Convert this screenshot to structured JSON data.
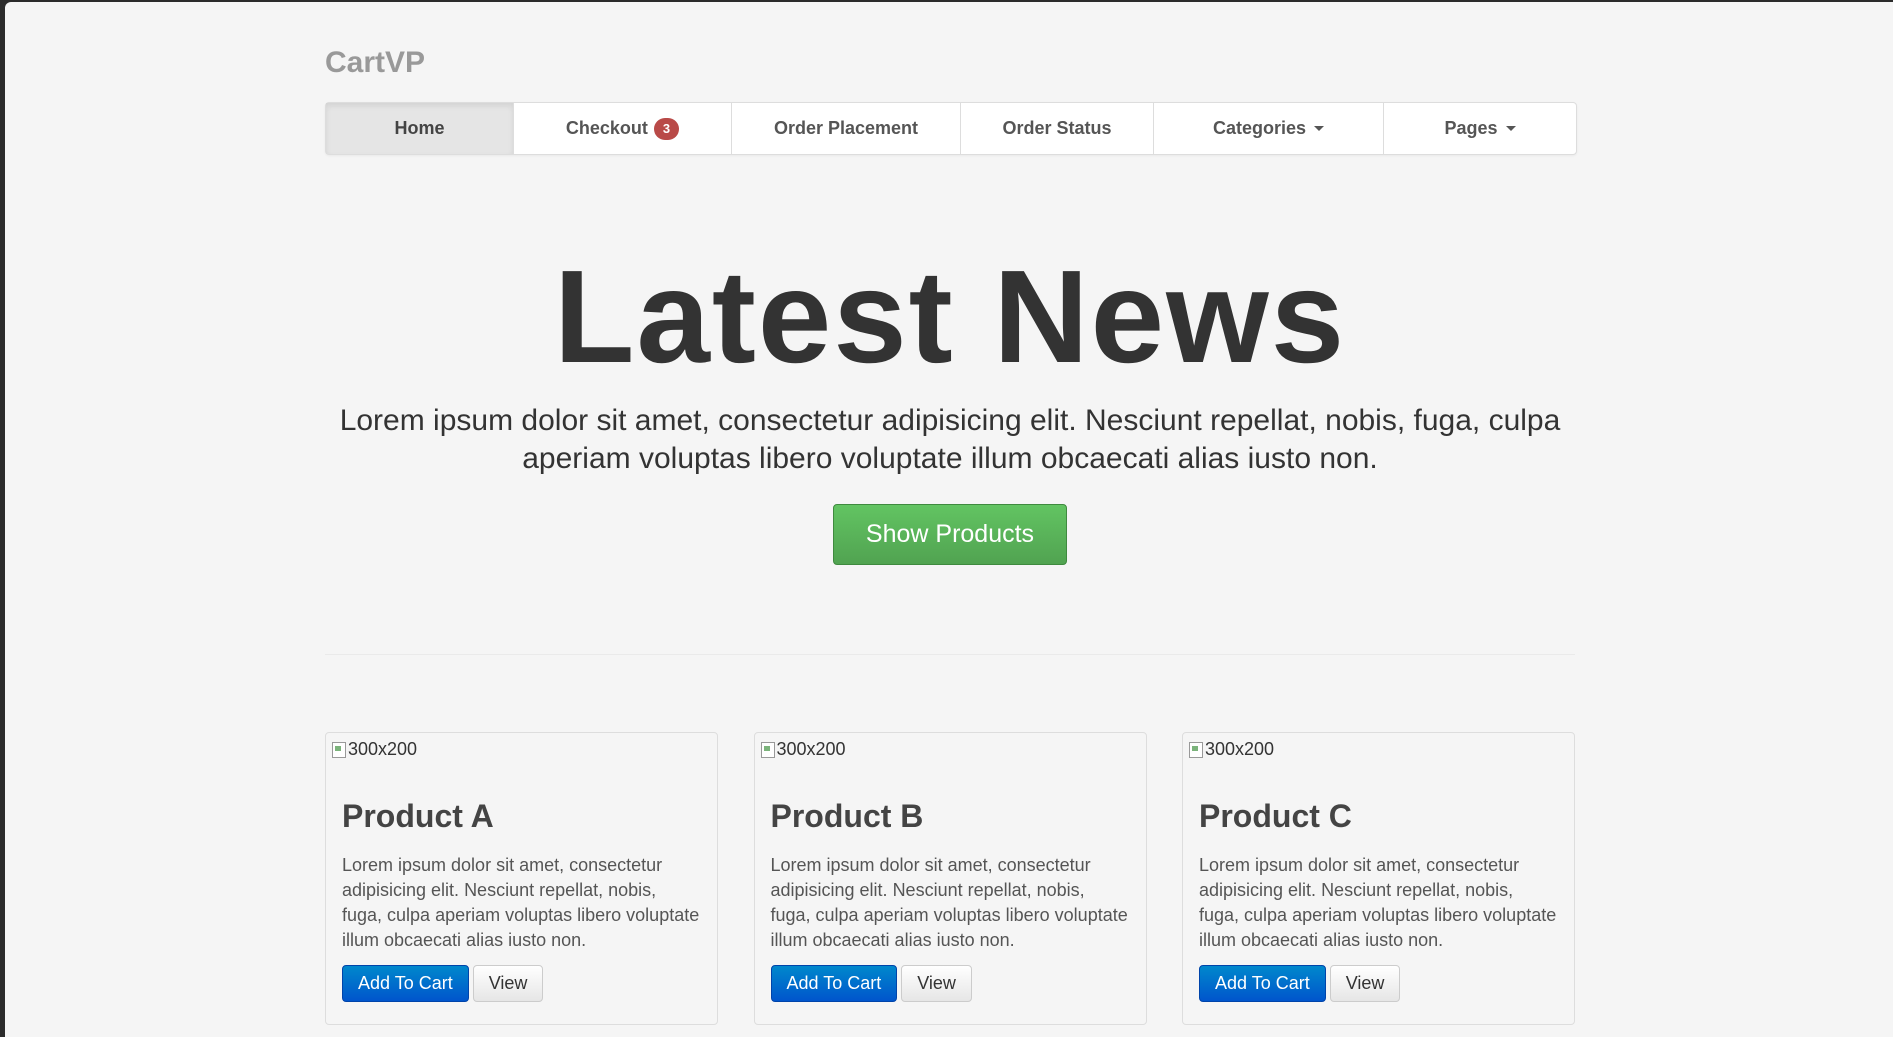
{
  "brand": "CartVP",
  "nav": {
    "home": "Home",
    "checkout": "Checkout",
    "checkout_badge": "3",
    "order_placement": "Order Placement",
    "order_status": "Order Status",
    "categories": "Categories",
    "pages": "Pages"
  },
  "hero": {
    "title": "Latest News",
    "text": "Lorem ipsum dolor sit amet, consectetur adipisicing elit. Nesciunt repellat, nobis, fuga, culpa aperiam voluptas libero voluptate illum obcaecati alias iusto non.",
    "button": "Show Products"
  },
  "products": [
    {
      "image_alt": "300x200",
      "title": "Product A",
      "description": "Lorem ipsum dolor sit amet, consectetur adipisicing elit. Nesciunt repellat, nobis, fuga, culpa aperiam voluptas libero voluptate illum obcaecati alias iusto non.",
      "add_label": "Add To Cart",
      "view_label": "View"
    },
    {
      "image_alt": "300x200",
      "title": "Product B",
      "description": "Lorem ipsum dolor sit amet, consectetur adipisicing elit. Nesciunt repellat, nobis, fuga, culpa aperiam voluptas libero voluptate illum obcaecati alias iusto non.",
      "add_label": "Add To Cart",
      "view_label": "View"
    },
    {
      "image_alt": "300x200",
      "title": "Product C",
      "description": "Lorem ipsum dolor sit amet, consectetur adipisicing elit. Nesciunt repellat, nobis, fuga, culpa aperiam voluptas libero voluptate illum obcaecati alias iusto non.",
      "add_label": "Add To Cart",
      "view_label": "View"
    }
  ],
  "colors": {
    "primary": "#0066cc",
    "success": "#5bb75b",
    "badge": "#b94a48"
  }
}
